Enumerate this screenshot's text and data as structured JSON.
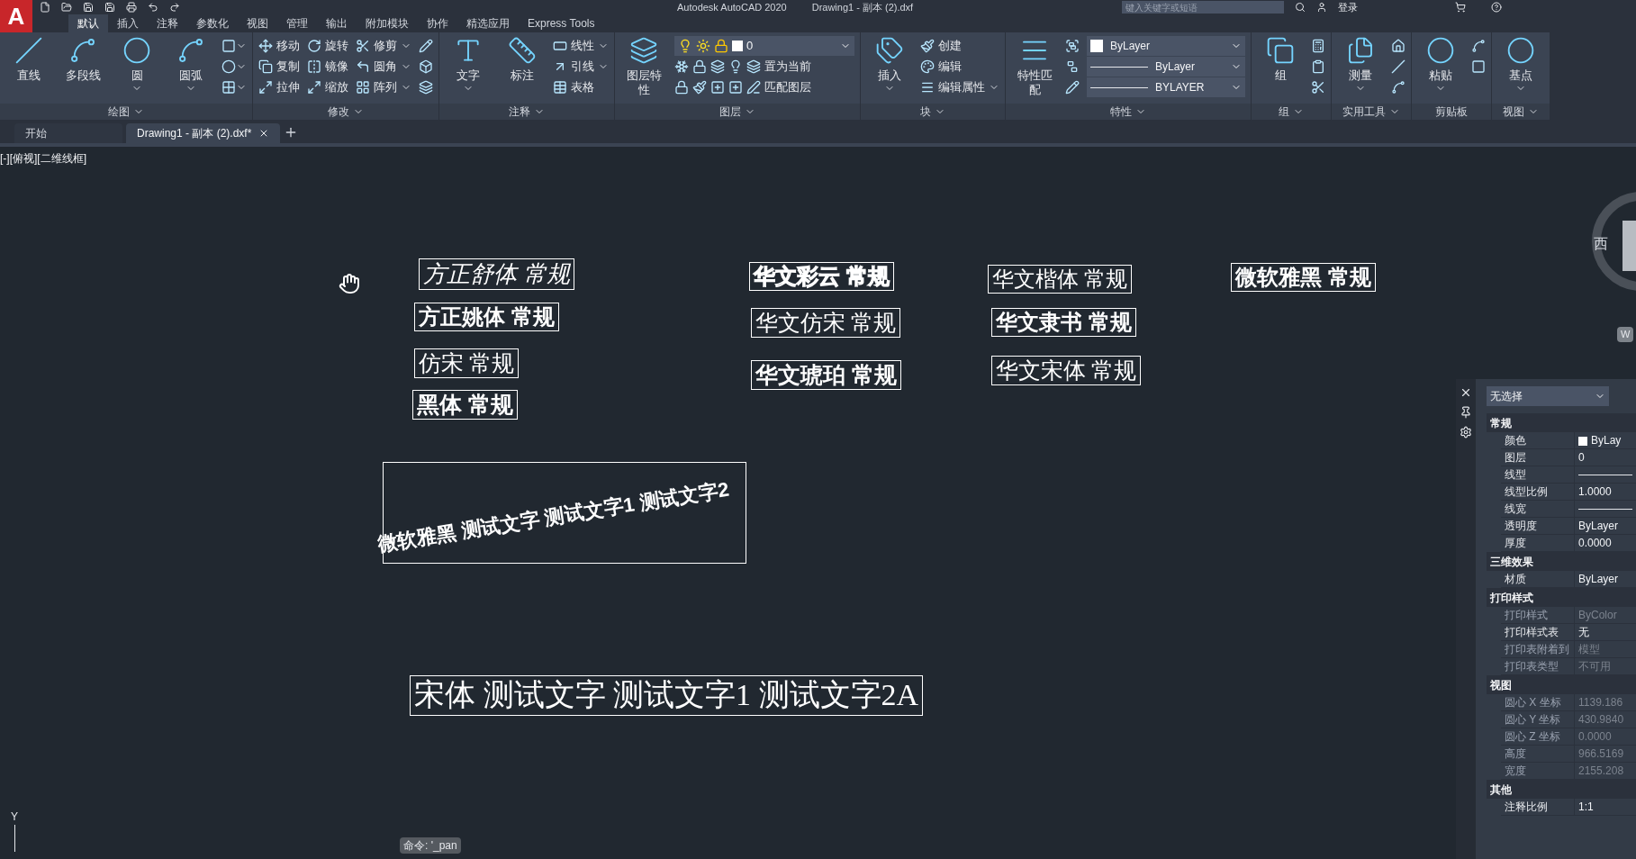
{
  "app_button": {
    "label": "A"
  },
  "title_bar": {
    "app": "Autodesk AutoCAD 2020",
    "file": "Drawing1 - 副本 (2).dxf",
    "search_placeholder": "键入关键字或短语",
    "login": "登录"
  },
  "ribbon_tabs": [
    {
      "label": "默认",
      "selected": true
    },
    {
      "label": "插入",
      "selected": false
    },
    {
      "label": "注释",
      "selected": false
    },
    {
      "label": "参数化",
      "selected": false
    },
    {
      "label": "视图",
      "selected": false
    },
    {
      "label": "管理",
      "selected": false
    },
    {
      "label": "输出",
      "selected": false
    },
    {
      "label": "附加模块",
      "selected": false
    },
    {
      "label": "协作",
      "selected": false
    },
    {
      "label": "精选应用",
      "selected": false
    },
    {
      "label": "Express Tools",
      "selected": false
    }
  ],
  "ribbon_panels": [
    {
      "title": "绘图",
      "has_menu": true,
      "columns": [
        [
          {
            "kind": "large",
            "label": "直线",
            "caret": false
          }
        ],
        [
          {
            "kind": "large",
            "label": "多段线",
            "caret": false
          }
        ],
        [
          {
            "kind": "large",
            "label": "圆",
            "caret": true
          }
        ],
        [
          {
            "kind": "large",
            "label": "圆弧",
            "caret": true
          }
        ],
        [
          {
            "kind": "icon",
            "caret": true
          },
          {
            "kind": "icon",
            "caret": true
          },
          {
            "kind": "icon",
            "caret": true
          }
        ]
      ]
    },
    {
      "title": "修改",
      "has_menu": true,
      "columns": [
        [
          {
            "kind": "small",
            "label": "移动",
            "caret": false
          },
          {
            "kind": "small",
            "label": "复制",
            "caret": false
          },
          {
            "kind": "small",
            "label": "拉伸",
            "caret": false
          }
        ],
        [
          {
            "kind": "small",
            "label": "旋转",
            "caret": false
          },
          {
            "kind": "small",
            "label": "镜像",
            "caret": false
          },
          {
            "kind": "small",
            "label": "缩放",
            "caret": false
          }
        ],
        [
          {
            "kind": "small",
            "label": "修剪",
            "caret": true
          },
          {
            "kind": "small",
            "label": "圆角",
            "caret": true
          },
          {
            "kind": "small",
            "label": "阵列",
            "caret": true
          }
        ],
        [
          {
            "kind": "icon",
            "caret": false
          },
          {
            "kind": "icon",
            "caret": false
          },
          {
            "kind": "icon",
            "caret": false
          }
        ]
      ]
    },
    {
      "title": "注释",
      "has_menu": true,
      "columns": [
        [
          {
            "kind": "large",
            "label": "文字",
            "caret": true
          }
        ],
        [
          {
            "kind": "large",
            "label": "标注",
            "caret": false
          }
        ],
        [
          {
            "kind": "small",
            "label": "线性",
            "caret": true
          },
          {
            "kind": "small",
            "label": "引线",
            "caret": true
          },
          {
            "kind": "small",
            "label": "表格",
            "caret": false
          }
        ]
      ]
    },
    {
      "title": "图层",
      "has_menu": true,
      "columns": [
        [
          {
            "kind": "large",
            "label": "图层特性",
            "caret": false
          }
        ],
        [
          {
            "kind": "layer_combo",
            "value": "0"
          },
          {
            "kind": "group",
            "items": [
              {
                "kind": "icon",
                "caret": false
              },
              {
                "kind": "icon",
                "caret": false
              },
              {
                "kind": "icon",
                "caret": false
              },
              {
                "kind": "icon",
                "caret": false
              },
              {
                "kind": "small",
                "label": "置为当前",
                "caret": false
              }
            ]
          },
          {
            "kind": "group",
            "items": [
              {
                "kind": "icon",
                "caret": false
              },
              {
                "kind": "icon",
                "caret": false
              },
              {
                "kind": "icon",
                "caret": false
              },
              {
                "kind": "icon",
                "caret": false
              },
              {
                "kind": "small",
                "label": "匹配图层",
                "caret": false
              }
            ]
          }
        ]
      ]
    },
    {
      "title": "块",
      "has_menu": true,
      "columns": [
        [
          {
            "kind": "large",
            "label": "插入",
            "caret": true
          }
        ],
        [
          {
            "kind": "small",
            "label": "创建",
            "caret": false
          },
          {
            "kind": "small",
            "label": "编辑",
            "caret": false
          },
          {
            "kind": "small",
            "label": "编辑属性",
            "caret": true
          }
        ]
      ]
    },
    {
      "title": "特性",
      "has_menu": true,
      "columns": [
        [
          {
            "kind": "large",
            "label": "特性匹配",
            "caret": false
          }
        ],
        [
          {
            "kind": "icon",
            "caret": false
          },
          {
            "kind": "icon",
            "caret": false
          },
          {
            "kind": "icon",
            "caret": false
          }
        ],
        [
          {
            "kind": "color_combo",
            "value": "ByLayer"
          },
          {
            "kind": "line_combo",
            "value": "ByLayer"
          },
          {
            "kind": "line_combo",
            "value": "BYLAYER"
          }
        ]
      ]
    },
    {
      "title": "组",
      "has_menu": true,
      "columns": [
        [
          {
            "kind": "large",
            "label": "组",
            "caret": false
          }
        ],
        [
          {
            "kind": "icon",
            "caret": false
          },
          {
            "kind": "icon",
            "caret": false
          },
          {
            "kind": "icon",
            "caret": false
          }
        ]
      ]
    },
    {
      "title": "实用工具",
      "has_menu": true,
      "columns": [
        [
          {
            "kind": "large",
            "label": "测量",
            "caret": true
          }
        ],
        [
          {
            "kind": "icon",
            "caret": false
          },
          {
            "kind": "icon",
            "caret": false
          },
          {
            "kind": "icon",
            "caret": false
          }
        ]
      ]
    },
    {
      "title": "剪贴板",
      "has_menu": false,
      "columns": [
        [
          {
            "kind": "large",
            "label": "粘贴",
            "caret": true
          }
        ],
        [
          {
            "kind": "icon",
            "caret": false
          },
          {
            "kind": "icon",
            "caret": false
          }
        ]
      ]
    },
    {
      "title": "视图",
      "has_menu": true,
      "columns": [
        [
          {
            "kind": "large",
            "label": "基点",
            "caret": true
          }
        ]
      ]
    }
  ],
  "doc_tabs": [
    {
      "label": "开始",
      "selected": false,
      "closable": false
    },
    {
      "label": "Drawing1 - 副本 (2).dxf*",
      "selected": true,
      "closable": true
    }
  ],
  "viewport_label": "[-][俯视][二维线框]",
  "canvas_texts": [
    {
      "text": "方正舒体 常规",
      "kind": "script"
    },
    {
      "text": "方正姚体 常规",
      "kind": "bold"
    },
    {
      "text": "仿宋 常规",
      "kind": "thin"
    },
    {
      "text": "黑体 常规",
      "kind": "bold"
    },
    {
      "text": "华文彩云 常规",
      "kind": "outline"
    },
    {
      "text": "华文仿宋 常规",
      "kind": "thin"
    },
    {
      "text": "华文琥珀 常规",
      "kind": "heavy"
    },
    {
      "text": "华文楷体 常规",
      "kind": "thin"
    },
    {
      "text": "华文隶书 常规",
      "kind": "heavy"
    },
    {
      "text": "华文宋体 常规",
      "kind": "thin"
    },
    {
      "text": "微软雅黑 常规",
      "kind": "heavy"
    },
    {
      "text": "微软雅黑 测试文字 测试文字1 测试文字2",
      "kind": "rotated"
    },
    {
      "text": "宋体 测试文字 测试文字1 测试文字2A",
      "kind": "large_serif"
    }
  ],
  "ucs_label": "Y",
  "viewcube": {
    "west": "西",
    "compass_button": "W"
  },
  "command_line": "命令: '_pan",
  "properties": {
    "selection": "无选择",
    "sections": [
      {
        "title": "常规",
        "rows": [
          {
            "label": "颜色",
            "value": "ByLay",
            "kind": "color",
            "disabled": false
          },
          {
            "label": "图层",
            "value": "0",
            "kind": "text",
            "disabled": false
          },
          {
            "label": "线型",
            "kind": "line",
            "disabled": false
          },
          {
            "label": "线型比例",
            "value": "1.0000",
            "kind": "text",
            "disabled": false
          },
          {
            "label": "线宽",
            "kind": "line",
            "disabled": false
          },
          {
            "label": "透明度",
            "value": "ByLayer",
            "kind": "text",
            "disabled": false
          },
          {
            "label": "厚度",
            "value": "0.0000",
            "kind": "text",
            "disabled": false
          }
        ]
      },
      {
        "title": "三维效果",
        "rows": [
          {
            "label": "材质",
            "value": "ByLayer",
            "kind": "text",
            "disabled": false
          }
        ]
      },
      {
        "title": "打印样式",
        "rows": [
          {
            "label": "打印样式",
            "value": "ByColor",
            "kind": "text",
            "disabled": true
          },
          {
            "label": "打印样式表",
            "value": "无",
            "kind": "text",
            "disabled": false
          },
          {
            "label": "打印表附着到",
            "value": "模型",
            "kind": "text",
            "disabled": true
          },
          {
            "label": "打印表类型",
            "value": "不可用",
            "kind": "text",
            "disabled": true
          }
        ]
      },
      {
        "title": "视图",
        "rows": [
          {
            "label": "圆心 X 坐标",
            "value": "1139.186",
            "kind": "text",
            "disabled": true
          },
          {
            "label": "圆心 Y 坐标",
            "value": "430.9840",
            "kind": "text",
            "disabled": true
          },
          {
            "label": "圆心 Z 坐标",
            "value": "0.0000",
            "kind": "text",
            "disabled": true
          },
          {
            "label": "高度",
            "value": "966.5169",
            "kind": "text",
            "disabled": true
          },
          {
            "label": "宽度",
            "value": "2155.208",
            "kind": "text",
            "disabled": true
          }
        ]
      },
      {
        "title": "其他",
        "rows": [
          {
            "label": "注释比例",
            "value": "1:1",
            "kind": "text",
            "disabled": false
          }
        ]
      }
    ]
  }
}
